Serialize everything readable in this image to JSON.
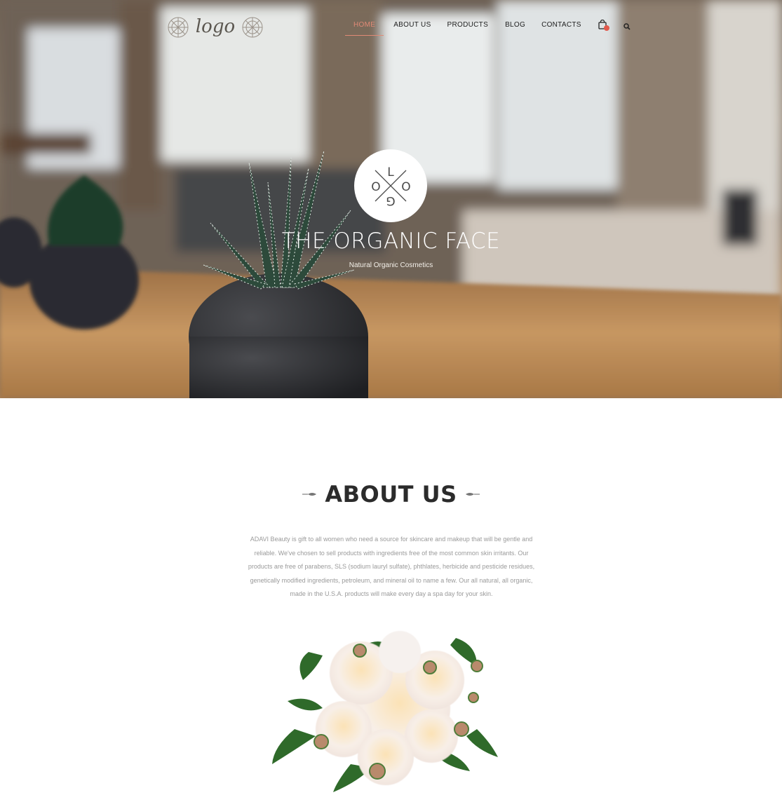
{
  "header": {
    "logo_text": "logo",
    "nav": [
      {
        "label": "HOME",
        "active": true
      },
      {
        "label": "ABOUT US",
        "active": false
      },
      {
        "label": "PRODUCTS",
        "active": false
      },
      {
        "label": "BLOG",
        "active": false
      },
      {
        "label": "CONTACTS",
        "active": false
      }
    ],
    "cart_icon": "shopping-bag-icon",
    "search_icon": "search-icon",
    "accent_color": "#e08a76"
  },
  "hero": {
    "badge_letters": [
      "L",
      "O",
      "G",
      "O"
    ],
    "title": "THE ORGANIC FACE",
    "subtitle": "Natural Organic Cosmetics"
  },
  "about": {
    "title": "ABOUT US",
    "paragraph": "ADAVI Beauty is gift to all women who need a source for skincare and makeup that will be gentle and reliable. We've chosen to sell products with ingredients free of the most common skin irritants. Our products are free of parabens, SLS (sodium lauryl sulfate), phthlates, herbicide and pesticide residues, genetically modified ingredients, petroleum, and mineral oil to name a few. Our all natural, all organic, made in the U.S.A. products will make every day a spa day for your skin."
  }
}
